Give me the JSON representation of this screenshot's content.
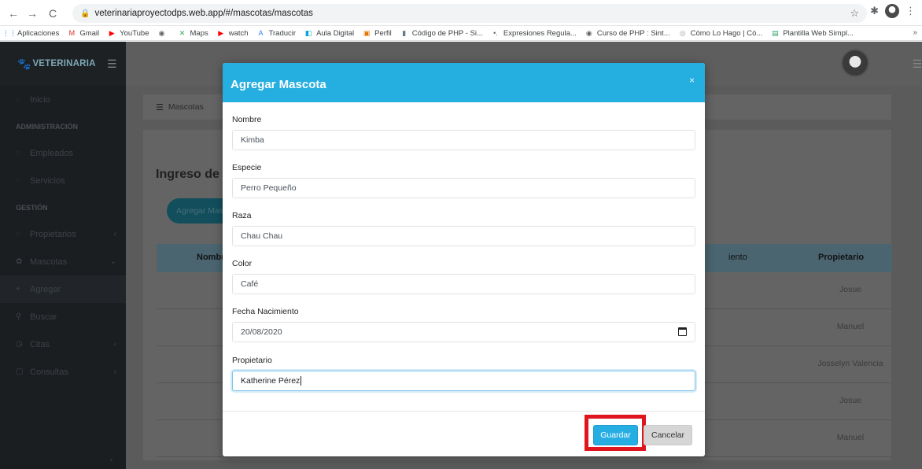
{
  "browser": {
    "url": "veterinariaproyectodps.web.app/#/mascotas/mascotas",
    "bookmarks": [
      {
        "label": "Aplicaciones",
        "icon": "apps-grid-icon",
        "color": "#1a73e8"
      },
      {
        "label": "Gmail",
        "icon": "gmail-icon",
        "color": "#d93025"
      },
      {
        "label": "YouTube",
        "icon": "youtube-icon",
        "color": "#ff0000"
      },
      {
        "label": "",
        "icon": "globe-icon",
        "color": "#5f6368"
      },
      {
        "label": "Maps",
        "icon": "maps-icon",
        "color": "#34a853"
      },
      {
        "label": "watch",
        "icon": "youtube-icon",
        "color": "#ff0000"
      },
      {
        "label": "Traducir",
        "icon": "translate-icon",
        "color": "#4285f4"
      },
      {
        "label": "Aula Digital",
        "icon": "aula-icon",
        "color": "#0aa6d9"
      },
      {
        "label": "Perfil",
        "icon": "profile-icon",
        "color": "#e37400"
      },
      {
        "label": "Código de PHP - Si...",
        "icon": "php-icon",
        "color": "#607d8b"
      },
      {
        "label": "Expresiones Regula...",
        "icon": "regex-icon",
        "color": "#5f6368"
      },
      {
        "label": "Curso de PHP : Sint...",
        "icon": "globe-icon",
        "color": "#5f6368"
      },
      {
        "label": "Cómo Lo Hago | Có...",
        "icon": "howto-icon",
        "color": "#9e9e9e"
      },
      {
        "label": "Plantilla Web Simpl...",
        "icon": "template-icon",
        "color": "#2ea56b"
      }
    ]
  },
  "app": {
    "brand": "VETERINARIA",
    "sidebar": {
      "items": [
        {
          "type": "item",
          "label": "Inicio",
          "icon": "home-icon"
        },
        {
          "type": "header",
          "label": "ADMINISTRACIÓN"
        },
        {
          "type": "item",
          "label": "Empleados",
          "icon": "user-icon"
        },
        {
          "type": "item",
          "label": "Servicios",
          "icon": "services-icon"
        },
        {
          "type": "header",
          "label": "GESTIÓN"
        },
        {
          "type": "item",
          "label": "Propietarios",
          "icon": "users-icon",
          "chevron": "‹"
        },
        {
          "type": "item",
          "label": "Mascotas",
          "icon": "paw-icon",
          "chevron": "⌄"
        },
        {
          "type": "item",
          "label": "Agregar",
          "icon": "plus-icon",
          "active": true
        },
        {
          "type": "item",
          "label": "Buscar",
          "icon": "search-icon"
        },
        {
          "type": "item",
          "label": "Citas",
          "icon": "clock-icon",
          "chevron": "‹"
        },
        {
          "type": "item",
          "label": "Consultas",
          "icon": "doc-icon",
          "chevron": "‹"
        }
      ]
    },
    "breadcrumb": "Mascotas",
    "page_title": "Ingreso de",
    "add_button": "Agregar Mas",
    "table": {
      "headers": [
        "Nombr",
        "iento",
        "Propietario"
      ],
      "rows": [
        {
          "owner": "Josue"
        },
        {
          "owner": "Manuel"
        },
        {
          "owner": "Josselyn Valencia"
        },
        {
          "owner": "Josue"
        },
        {
          "owner": "Manuel"
        }
      ]
    }
  },
  "modal": {
    "title": "Agregar Mascota",
    "close": "×",
    "fields": [
      {
        "label": "Nombre",
        "value": "Kimba"
      },
      {
        "label": "Especie",
        "value": "Perro Pequeño"
      },
      {
        "label": "Raza",
        "value": "Chau Chau"
      },
      {
        "label": "Color",
        "value": "Café"
      },
      {
        "label": "Fecha Nacimiento",
        "value": "20/08/2020"
      },
      {
        "label": "Propietario",
        "value": "Katherine Pérez"
      }
    ],
    "save_label": "Guardar",
    "cancel_label": "Cancelar",
    "colors": {
      "header": "#25aee0",
      "save": "#26aee3",
      "highlight": "#e0161f"
    }
  }
}
